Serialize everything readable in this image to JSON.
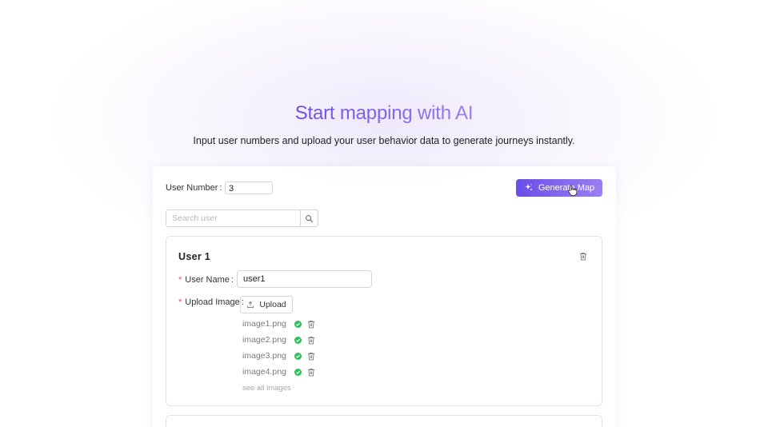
{
  "hero": {
    "title": "Start mapping with AI",
    "subtitle": "Input user numbers and upload your user behavior data to generate journeys instantly."
  },
  "controls": {
    "user_number_label": "User Number",
    "user_number_value": "3",
    "generate_label": "Generate Map",
    "search_placeholder": "Search user"
  },
  "user1": {
    "title": "User 1",
    "name_label": "User Name",
    "name_value": "user1",
    "upload_label": "Upload Image",
    "upload_button": "Upload",
    "files": [
      "image1.png",
      "image2.png",
      "image3.png",
      "image4.png"
    ],
    "see_all": "see all images"
  },
  "colors": {
    "accent_start": "#6a4ee6",
    "accent_end": "#9a7ff2",
    "success": "#2fbf5b",
    "required": "#e0524f"
  },
  "icons": [
    "sparkle-icon",
    "pointer-cursor-icon",
    "search-icon",
    "trash-icon",
    "upload-icon",
    "check-circle-icon"
  ]
}
